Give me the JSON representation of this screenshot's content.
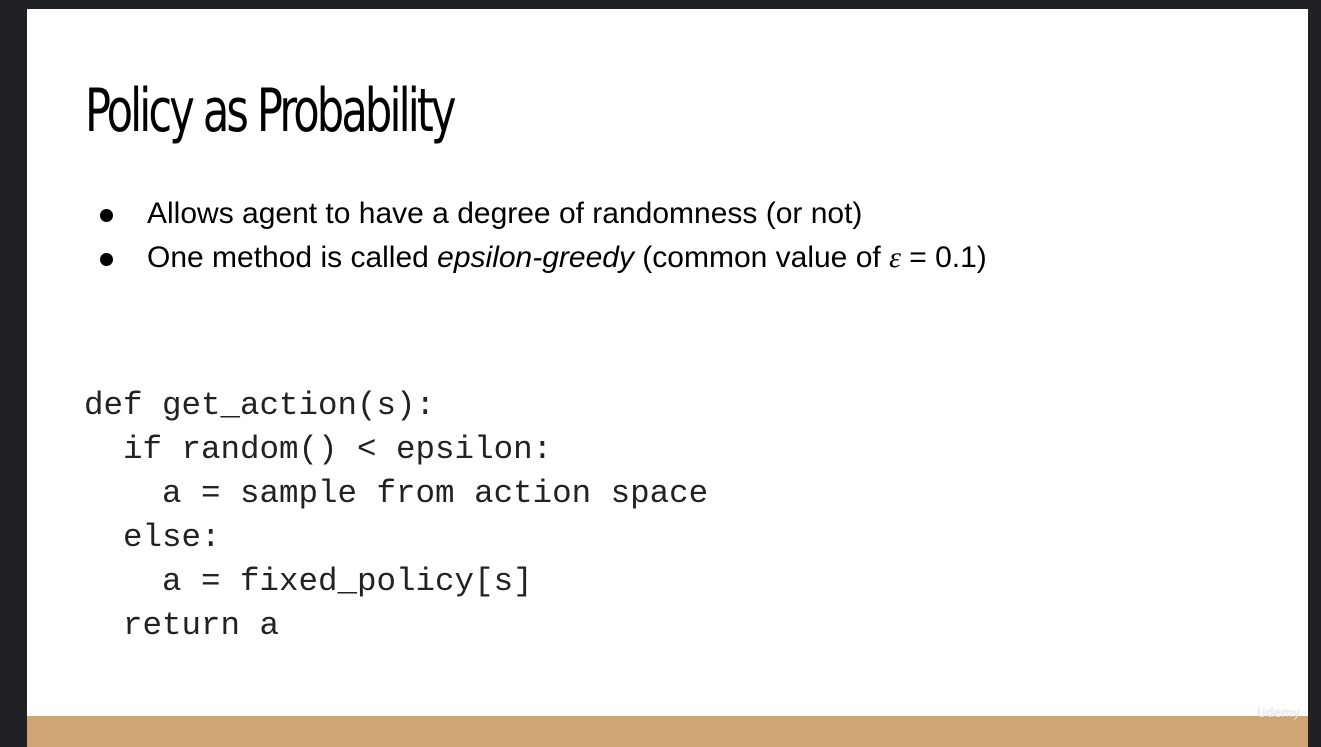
{
  "slide": {
    "title": "Policy as Probability",
    "bullets": [
      {
        "text": "Allows agent to have a degree of randomness (or not)"
      },
      {
        "pre": "One method is called ",
        "emphasis": "epsilon-greedy",
        "mid": " (common value of ",
        "symbol": "ε",
        "post": " = 0.1)"
      }
    ],
    "code": [
      "def get_action(s):",
      "  if random() < epsilon:",
      "    a = sample from action space",
      "  else:",
      "    a = fixed_policy[s]",
      "  return a"
    ],
    "footer_color": "#cfa673"
  },
  "watermark": "Udemy"
}
